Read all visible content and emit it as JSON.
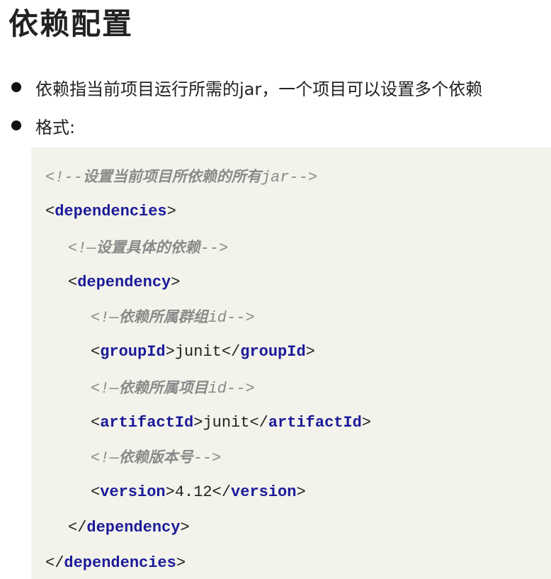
{
  "title": "依赖配置",
  "bullets": [
    "依赖指当前项目运行所需的jar，一个项目可以设置多个依赖",
    "格式:"
  ],
  "code": {
    "comment_all_deps_cn": "设置当前项目所依赖的所有",
    "comment_all_deps_tail": "jar-->",
    "comment_open": "<!--",
    "comment_open_short": "<!—",
    "comment_close": "-->",
    "tag_dependencies": "dependencies",
    "tag_dependency": "dependency",
    "comment_specific_dep_cn": "设置具体的依赖",
    "comment_group_cn": "依赖所属群组",
    "comment_id_suffix": "id-->",
    "tag_groupId": "groupId",
    "groupId_value": "junit",
    "comment_artifact_cn": "依赖所属项目",
    "tag_artifactId": "artifactId",
    "artifactId_value": "junit",
    "comment_version_cn": "依赖版本号",
    "tag_version": "version",
    "version_value": "4.12"
  }
}
